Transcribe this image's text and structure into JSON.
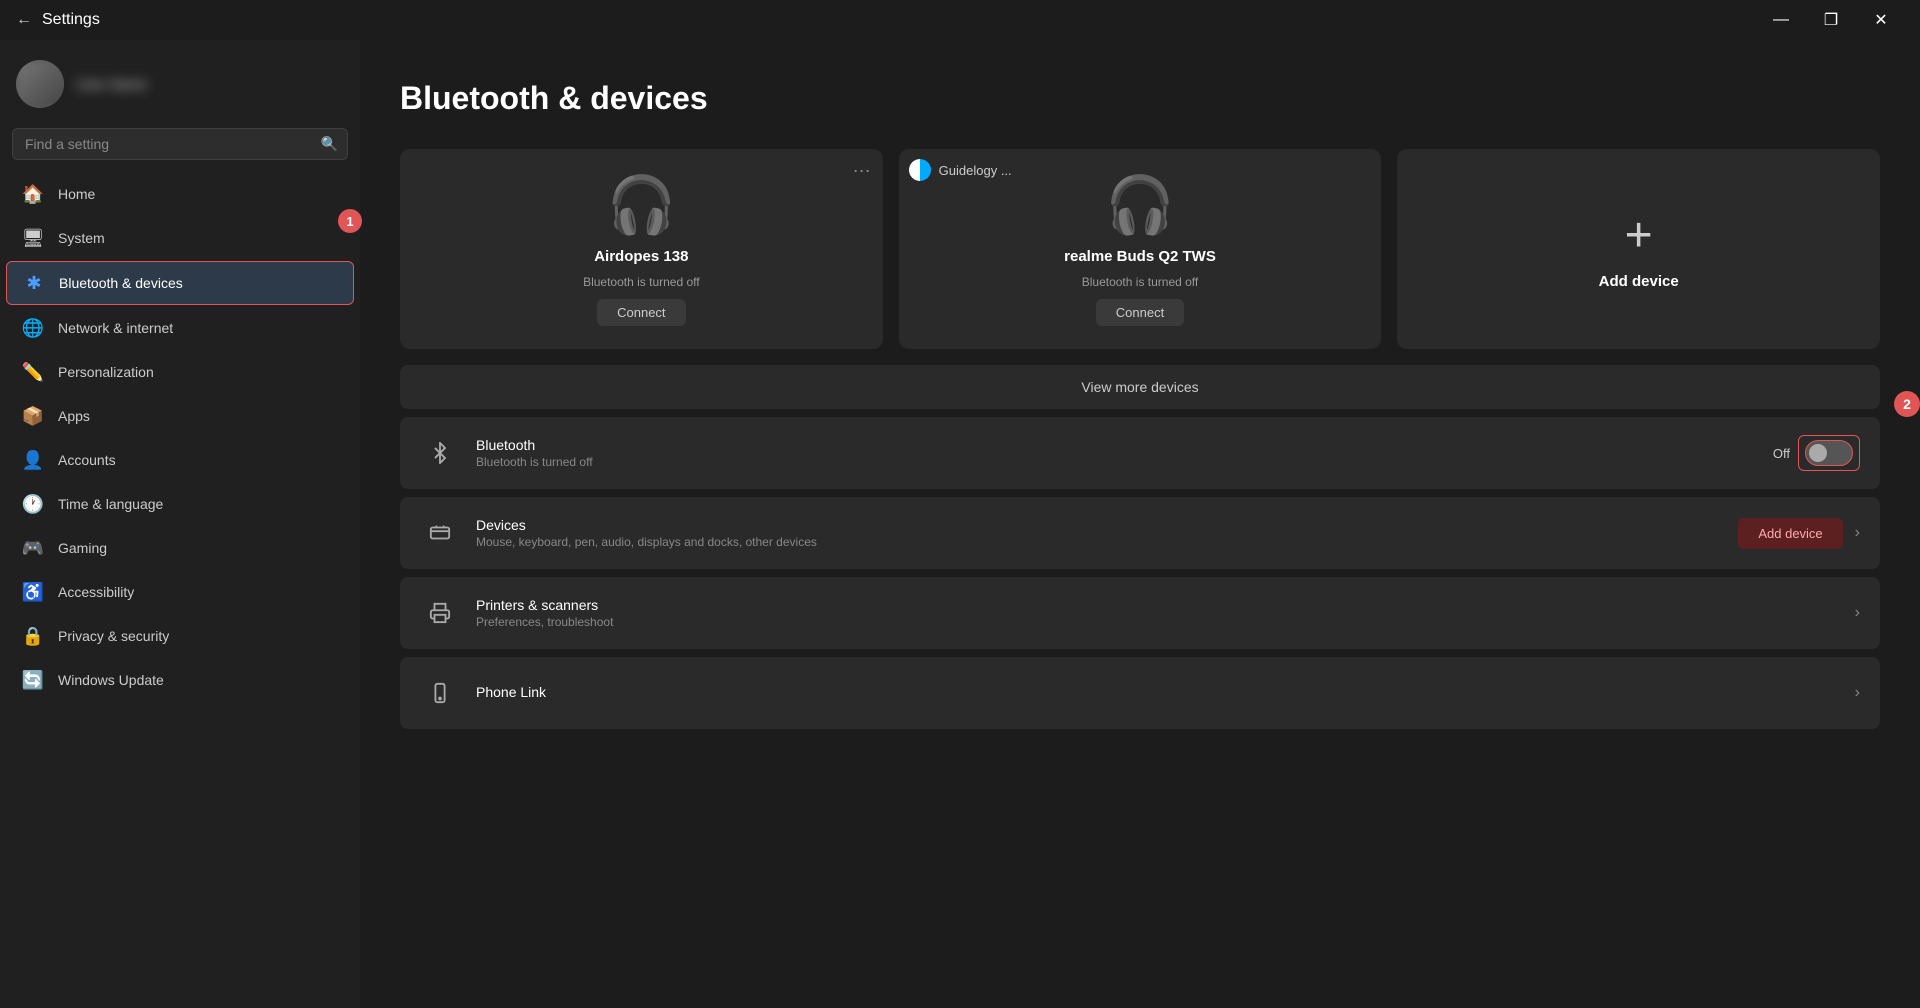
{
  "window": {
    "title": "Settings",
    "controls": {
      "minimize": "—",
      "maximize": "❐",
      "close": "✕"
    }
  },
  "sidebar": {
    "search_placeholder": "Find a setting",
    "user_name": "User Name",
    "nav_items": [
      {
        "id": "home",
        "label": "Home",
        "icon": "🏠"
      },
      {
        "id": "system",
        "label": "System",
        "icon": "🖥",
        "badge": "1"
      },
      {
        "id": "bluetooth",
        "label": "Bluetooth & devices",
        "icon": "✱",
        "active": true
      },
      {
        "id": "network",
        "label": "Network & internet",
        "icon": "🌐"
      },
      {
        "id": "personalization",
        "label": "Personalization",
        "icon": "✏️"
      },
      {
        "id": "apps",
        "label": "Apps",
        "icon": "📦"
      },
      {
        "id": "accounts",
        "label": "Accounts",
        "icon": "👤"
      },
      {
        "id": "time",
        "label": "Time & language",
        "icon": "🕐"
      },
      {
        "id": "gaming",
        "label": "Gaming",
        "icon": "🎮"
      },
      {
        "id": "accessibility",
        "label": "Accessibility",
        "icon": "♿"
      },
      {
        "id": "privacy",
        "label": "Privacy & security",
        "icon": "🔒"
      },
      {
        "id": "update",
        "label": "Windows Update",
        "icon": "🔄"
      }
    ]
  },
  "main": {
    "title": "Bluetooth & devices",
    "devices": [
      {
        "id": "airdopes",
        "name": "Airdopes 138",
        "status": "Bluetooth is turned off",
        "connect_label": "Connect",
        "has_menu": true
      },
      {
        "id": "realme",
        "name": "realme Buds Q2 TWS",
        "status": "Bluetooth is turned off",
        "connect_label": "Connect",
        "has_guidelogy": true,
        "guidelogy_label": "Guidelogy ..."
      },
      {
        "id": "add",
        "name": "Add device",
        "is_add": true
      }
    ],
    "view_more": "View more devices",
    "bluetooth": {
      "name": "Bluetooth",
      "status": "Bluetooth is turned off",
      "toggle_label": "Off",
      "toggle_state": false
    },
    "devices_row": {
      "name": "Devices",
      "sub": "Mouse, keyboard, pen, audio, displays and docks, other devices",
      "add_label": "Add device"
    },
    "printers": {
      "name": "Printers & scanners",
      "sub": "Preferences, troubleshoot"
    },
    "phone_link": {
      "name": "Phone Link"
    }
  },
  "annotations": {
    "badge1_label": "1",
    "badge2_label": "2"
  }
}
